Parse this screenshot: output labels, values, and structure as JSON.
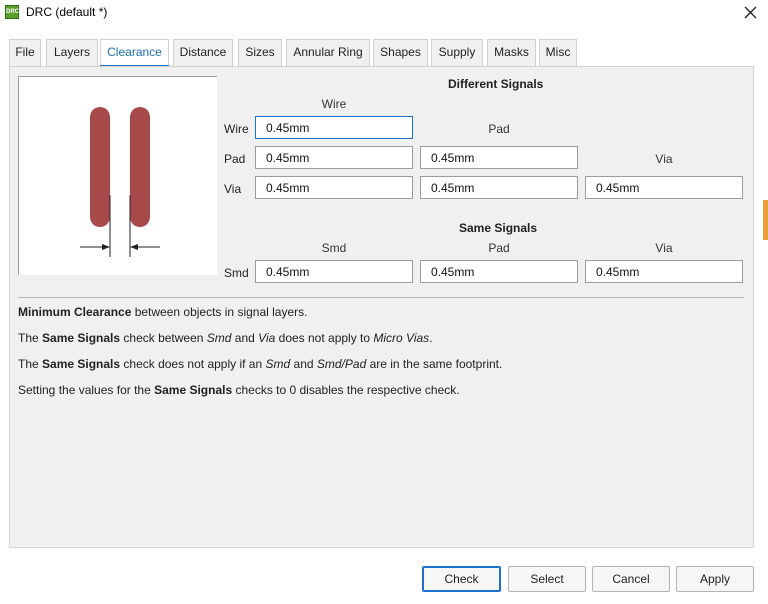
{
  "window": {
    "icon_label": "DRC",
    "title": "DRC (default *)"
  },
  "tabs": [
    {
      "label": "File",
      "active": false
    },
    {
      "label": "Layers",
      "active": false
    },
    {
      "label": "Clearance",
      "active": true
    },
    {
      "label": "Distance",
      "active": false
    },
    {
      "label": "Sizes",
      "active": false
    },
    {
      "label": "Annular Ring",
      "active": false
    },
    {
      "label": "Shapes",
      "active": false
    },
    {
      "label": "Supply",
      "active": false
    },
    {
      "label": "Masks",
      "active": false
    },
    {
      "label": "Misc",
      "active": false
    }
  ],
  "different_signals": {
    "heading": "Different Signals",
    "col_wire": "Wire",
    "col_pad": "Pad",
    "col_via": "Via",
    "rows": [
      {
        "label": "Wire",
        "values": [
          "0.45mm"
        ]
      },
      {
        "label": "Pad",
        "values": [
          "0.45mm",
          "0.45mm"
        ]
      },
      {
        "label": "Via",
        "values": [
          "0.45mm",
          "0.45mm",
          "0.45mm"
        ]
      }
    ]
  },
  "same_signals": {
    "heading": "Same Signals",
    "col_smd": "Smd",
    "col_pad": "Pad",
    "col_via": "Via",
    "rows": [
      {
        "label": "Smd",
        "values": [
          "0.45mm",
          "0.45mm",
          "0.45mm"
        ]
      }
    ]
  },
  "info": {
    "line1": {
      "b1": "Minimum Clearance",
      "t1": " between objects in signal layers."
    },
    "line2": {
      "t1": "The ",
      "b1": "Same Signals",
      "t2": " check between ",
      "i1": "Smd",
      "t3": " and ",
      "i2": "Via",
      "t4": " does not apply to ",
      "i3": "Micro Vias",
      "t5": "."
    },
    "line3": {
      "t1": "The ",
      "b1": "Same Signals",
      "t2": " check does not apply if an ",
      "i1": "Smd",
      "t3": " and ",
      "i2": "Smd/Pad",
      "t4": " are in the same footprint."
    },
    "line4": {
      "t1": "Setting the values for the ",
      "b1": "Same Signals",
      "t2": " checks to 0 disables the respective check."
    }
  },
  "buttons": {
    "check": "Check",
    "select": "Select",
    "cancel": "Cancel",
    "apply": "Apply"
  },
  "colors": {
    "accent": "#1a73c8",
    "pad_fill": "#a84a4a"
  },
  "icons": {
    "close": "close-icon",
    "app": "drc-app-icon"
  }
}
